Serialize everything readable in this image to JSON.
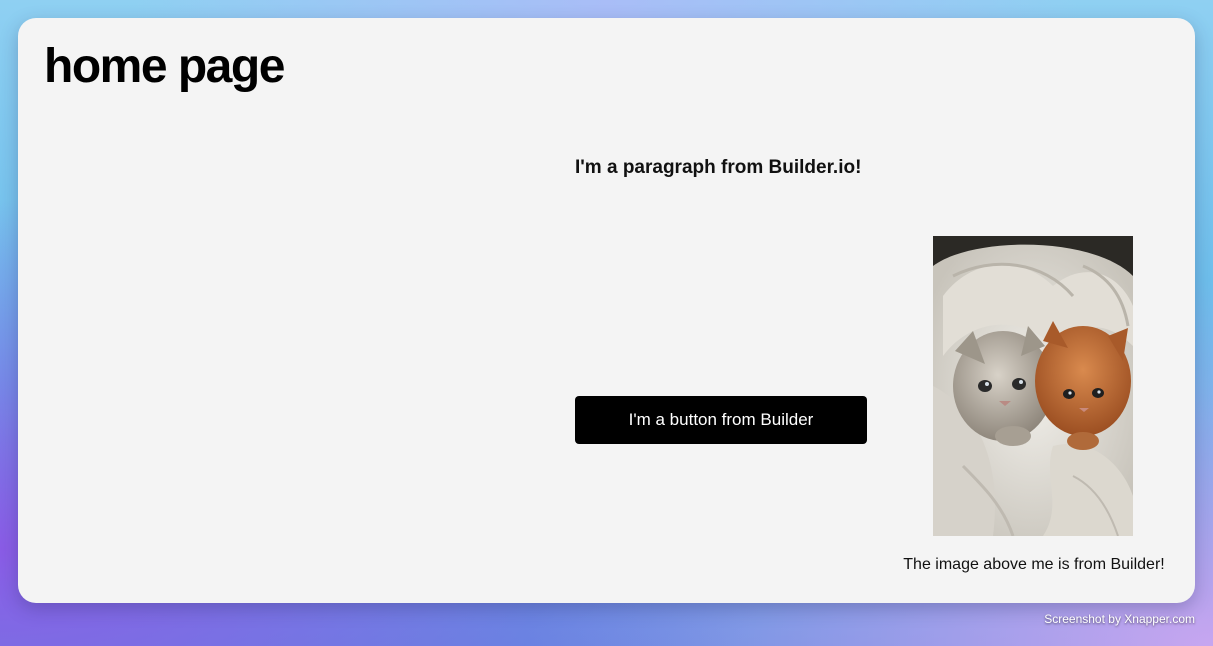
{
  "page": {
    "title": "home page",
    "paragraph": "I'm a paragraph from Builder.io!",
    "button_label": "I'm a button from Builder",
    "image_alt": "Two kittens in a white blanket",
    "image_caption": "The image above me is from Builder!"
  },
  "watermark": "Screenshot by Xnapper.com",
  "colors": {
    "card_background": "#f4f4f4",
    "button_background": "#000000",
    "button_text": "#ffffff",
    "text": "#000000"
  }
}
